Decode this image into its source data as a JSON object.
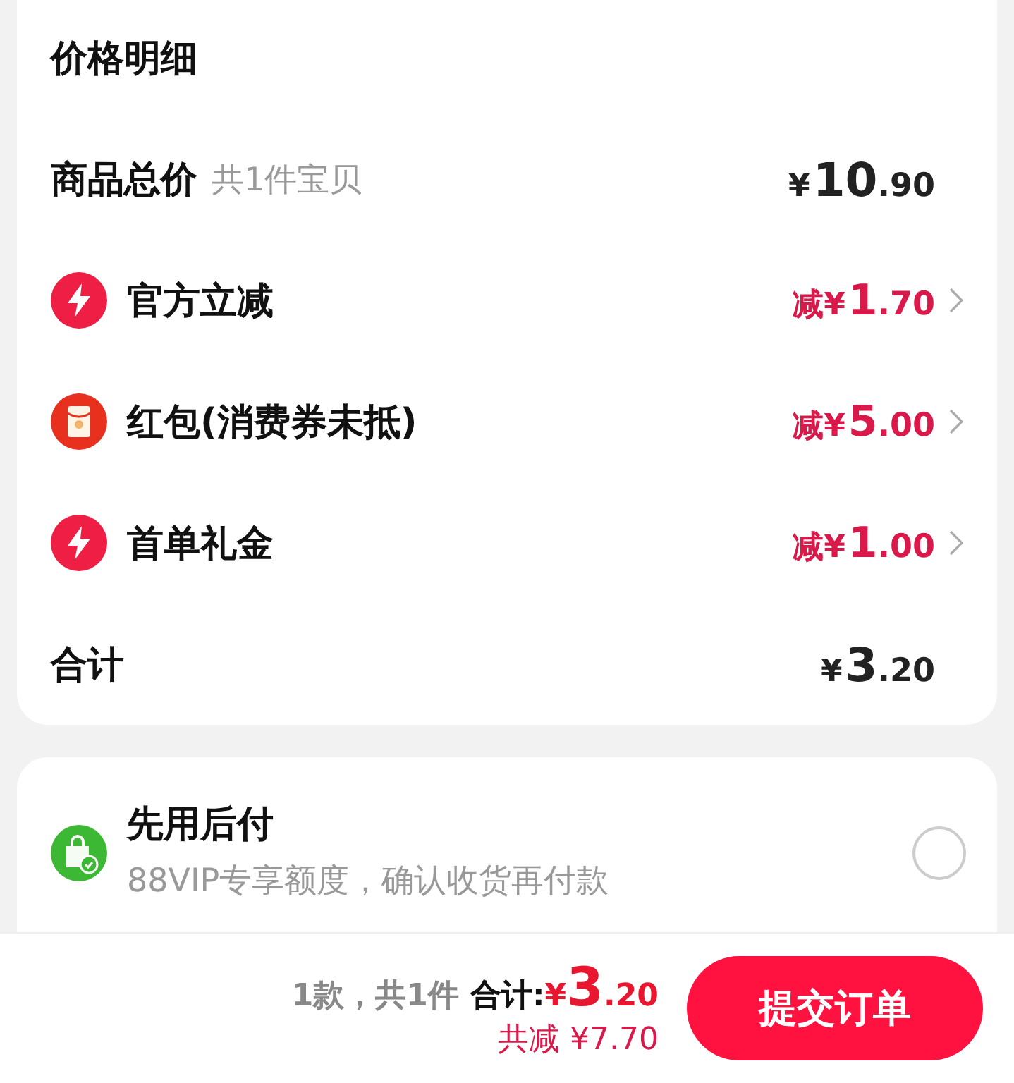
{
  "price_details": {
    "title": "价格明细",
    "rows": [
      {
        "kind": "total",
        "label": "商品总价",
        "note": "共1件宝贝",
        "amount": "¥10.90",
        "chevron": false
      },
      {
        "kind": "bolt",
        "label": "官方立减",
        "amount": "减¥1.70",
        "chevron": true
      },
      {
        "kind": "red-packet",
        "label": "红包(消费券未抵)",
        "amount": "减¥5.00",
        "chevron": true
      },
      {
        "kind": "bolt",
        "label": "首单礼金",
        "amount": "减¥1.00",
        "chevron": true
      },
      {
        "kind": "sum",
        "label": "合计",
        "amount": "¥3.20",
        "chevron": false
      }
    ]
  },
  "payment": {
    "title": "先用后付",
    "subtitle": "88VIP专享额度，确认收货再付款",
    "selected": false
  },
  "footer": {
    "count": "1款，共1件",
    "total_label": "合计:",
    "total": "¥3.20",
    "savings": "共减 ¥7.70",
    "submit": "提交订单"
  }
}
